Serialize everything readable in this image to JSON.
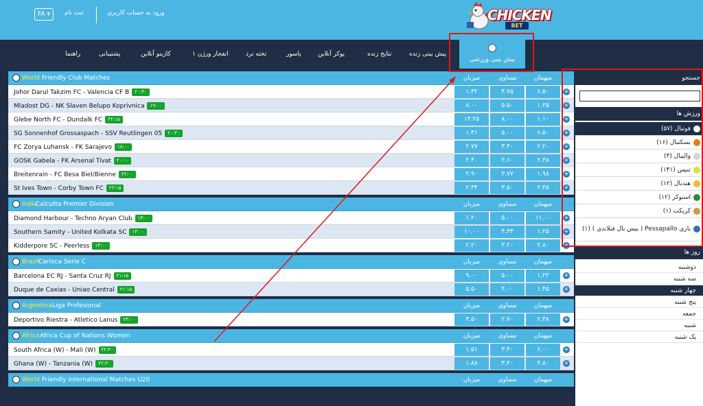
{
  "topbar": {
    "lang": "FA ▾",
    "register": "ثبت نام",
    "login": "ورود به حساب کاربری",
    "logo_text": "CHICKEN",
    "logo_sub": "BET"
  },
  "nav": {
    "active": "پیش بینی ورزشی",
    "items": [
      "پیش بینی زنده",
      "نتایج زنده",
      "پوکر آنلاین",
      "پاسور",
      "تخته نرد",
      "انفجار ورژن ۱",
      "کازینو آنلاین",
      "پشتیبانی",
      "راهنما"
    ]
  },
  "columns": {
    "home": "میزبان",
    "draw": "مساوی",
    "away": "میهمان"
  },
  "leagues": [
    {
      "country": "World",
      "name": "Friendly Club Matches",
      "matches": [
        {
          "teams": "Johor Darul Takzim FC  -  Valencia CF B",
          "time": "۲۰:۳۰",
          "home": "۱.۳۲",
          "draw": "۴.۷۵",
          "away": "۶.۵۰"
        },
        {
          "teams": "Mladost DG  -  NK Slaven Belupo Koprivnica",
          "time": "۱۹:۰۰",
          "home": "۸.۰۰",
          "draw": "۵.۵۰",
          "away": "۱.۲۵"
        },
        {
          "teams": "Glebe North FC  -  Dundalk FC",
          "time": "۲۲:۱۵",
          "home": "۱۳.۲۵",
          "draw": "۸.۰۰",
          "away": "۱.۱۰"
        },
        {
          "teams": "SG Sonnenhof Grossaspach  -  SSV Reutlingen 05",
          "time": "۲۰:۳۰",
          "home": "۱.۳۱",
          "draw": "۵.۰۰",
          "away": "۶.۵۰"
        },
        {
          "teams": "FC Zorya Luhansk  -  FK Sarajevo",
          "time": "۱۸:۰۰",
          "home": "۲.۷۷",
          "draw": "۳.۴۰",
          "away": "۲.۲۰"
        },
        {
          "teams": "GOSK Gabela  -  FK Arsenal Tivat",
          "time": "۲۰:۰۰",
          "home": "۲.۴۰",
          "draw": "۳.۶۰",
          "away": "۲.۳۸"
        },
        {
          "teams": "Breitenrain  -  FC Besa Biel/Bienne",
          "time": "۲۲:۰۰",
          "home": "۲.۹۰",
          "draw": "۳.۷۷",
          "away": "۱.۹۸"
        },
        {
          "teams": "St Ives Town  -  Corby Town FC",
          "time": "۲۲:۱۵",
          "home": "۲.۳۴",
          "draw": "۳.۵۰",
          "away": "۲.۴۵"
        }
      ]
    },
    {
      "country": "India",
      "name": "Calcutta Premier Division",
      "matches": [
        {
          "teams": "Diamond Harbour  -  Techno Aryan Club",
          "time": "۱۳:۰۰",
          "home": "۱.۲۰",
          "draw": "۵.۰۰",
          "away": "۱۱.۰۰"
        },
        {
          "teams": "Southern Samity  -  United Kolkata SC",
          "time": "۱۳:۰۰",
          "home": "۱۰.۰۰",
          "draw": "۴.۳۳",
          "away": "۱.۲۵"
        },
        {
          "teams": "Kidderpore SC  -  Peerless",
          "time": "۱۳:۰۰",
          "home": "۲.۲۰",
          "draw": "۳.۲۰",
          "away": "۲.۸۰"
        }
      ]
    },
    {
      "country": "Brazil",
      "name": "Carioca Serie C",
      "matches": [
        {
          "teams": "Barcelona EC RJ  -  Santa Cruz RJ",
          "time": "۲۱:۱۵",
          "home": "۹.۰۰",
          "draw": "۵.۰۰",
          "away": "۱.۲۲"
        },
        {
          "teams": "Duque de Caxias  -  Uniao Central",
          "time": "۲۱:۱۵",
          "home": "۵.۵۰",
          "draw": "۴.۰۰",
          "away": "۱.۴۵"
        }
      ]
    },
    {
      "country": "Argentina",
      "name": "Liga Profesional",
      "matches": [
        {
          "teams": "Deportivo Riestra  -  Atletico Lanus",
          "time": "۲۳:۰۰",
          "home": "۳.۵۰",
          "draw": "۲.۷۰",
          "away": "۲.۳۸"
        }
      ]
    },
    {
      "country": "Africa",
      "name": "Africa Cup of Nations Women",
      "matches": [
        {
          "teams": "South Africa (W)  -  Mali (W)",
          "time": "۲۲:۳۰",
          "home": "۱.۵۱",
          "draw": "۳.۴۰",
          "away": "۶.۰۰"
        },
        {
          "teams": "Ghana (W)  -  Tanzania (W)",
          "time": "۲۲:۳۰",
          "home": "۱.۸۸",
          "draw": "۳.۲۰",
          "away": "۳.۸۰"
        }
      ]
    },
    {
      "country": "World",
      "name": "Friendly International Matches U20",
      "matches": []
    }
  ],
  "sidebar": {
    "search_title": "جستجو",
    "sports_title": "ورزش ها",
    "sports": [
      {
        "label": "فوتبال (۵۷)",
        "color": "#ffffff"
      },
      {
        "label": "بسکتبال (۱۶)",
        "color": "#e87a1a"
      },
      {
        "label": "والیبال (۳)",
        "color": "#cfd6de"
      },
      {
        "label": "تنیس (۱۴۱)",
        "color": "#d6e43a"
      },
      {
        "label": "هندبال (۱۲)",
        "color": "#f0b83a"
      },
      {
        "label": "اسنوکر (۱۲)",
        "color": "#2c8a3a"
      },
      {
        "label": "کریکت (۱)",
        "color": "#c79a4a"
      },
      {
        "label": "بازی Pessapallo ( بیس بال فنلاندی ) (۱)",
        "color": "#3a6fb0"
      }
    ],
    "days_title": "روز ها",
    "days": [
      "دوشنبه",
      "سه شنبه",
      "چهار شنبه",
      "پنج شنبه",
      "جمعه",
      "شنبه",
      "یک شنبه"
    ]
  }
}
